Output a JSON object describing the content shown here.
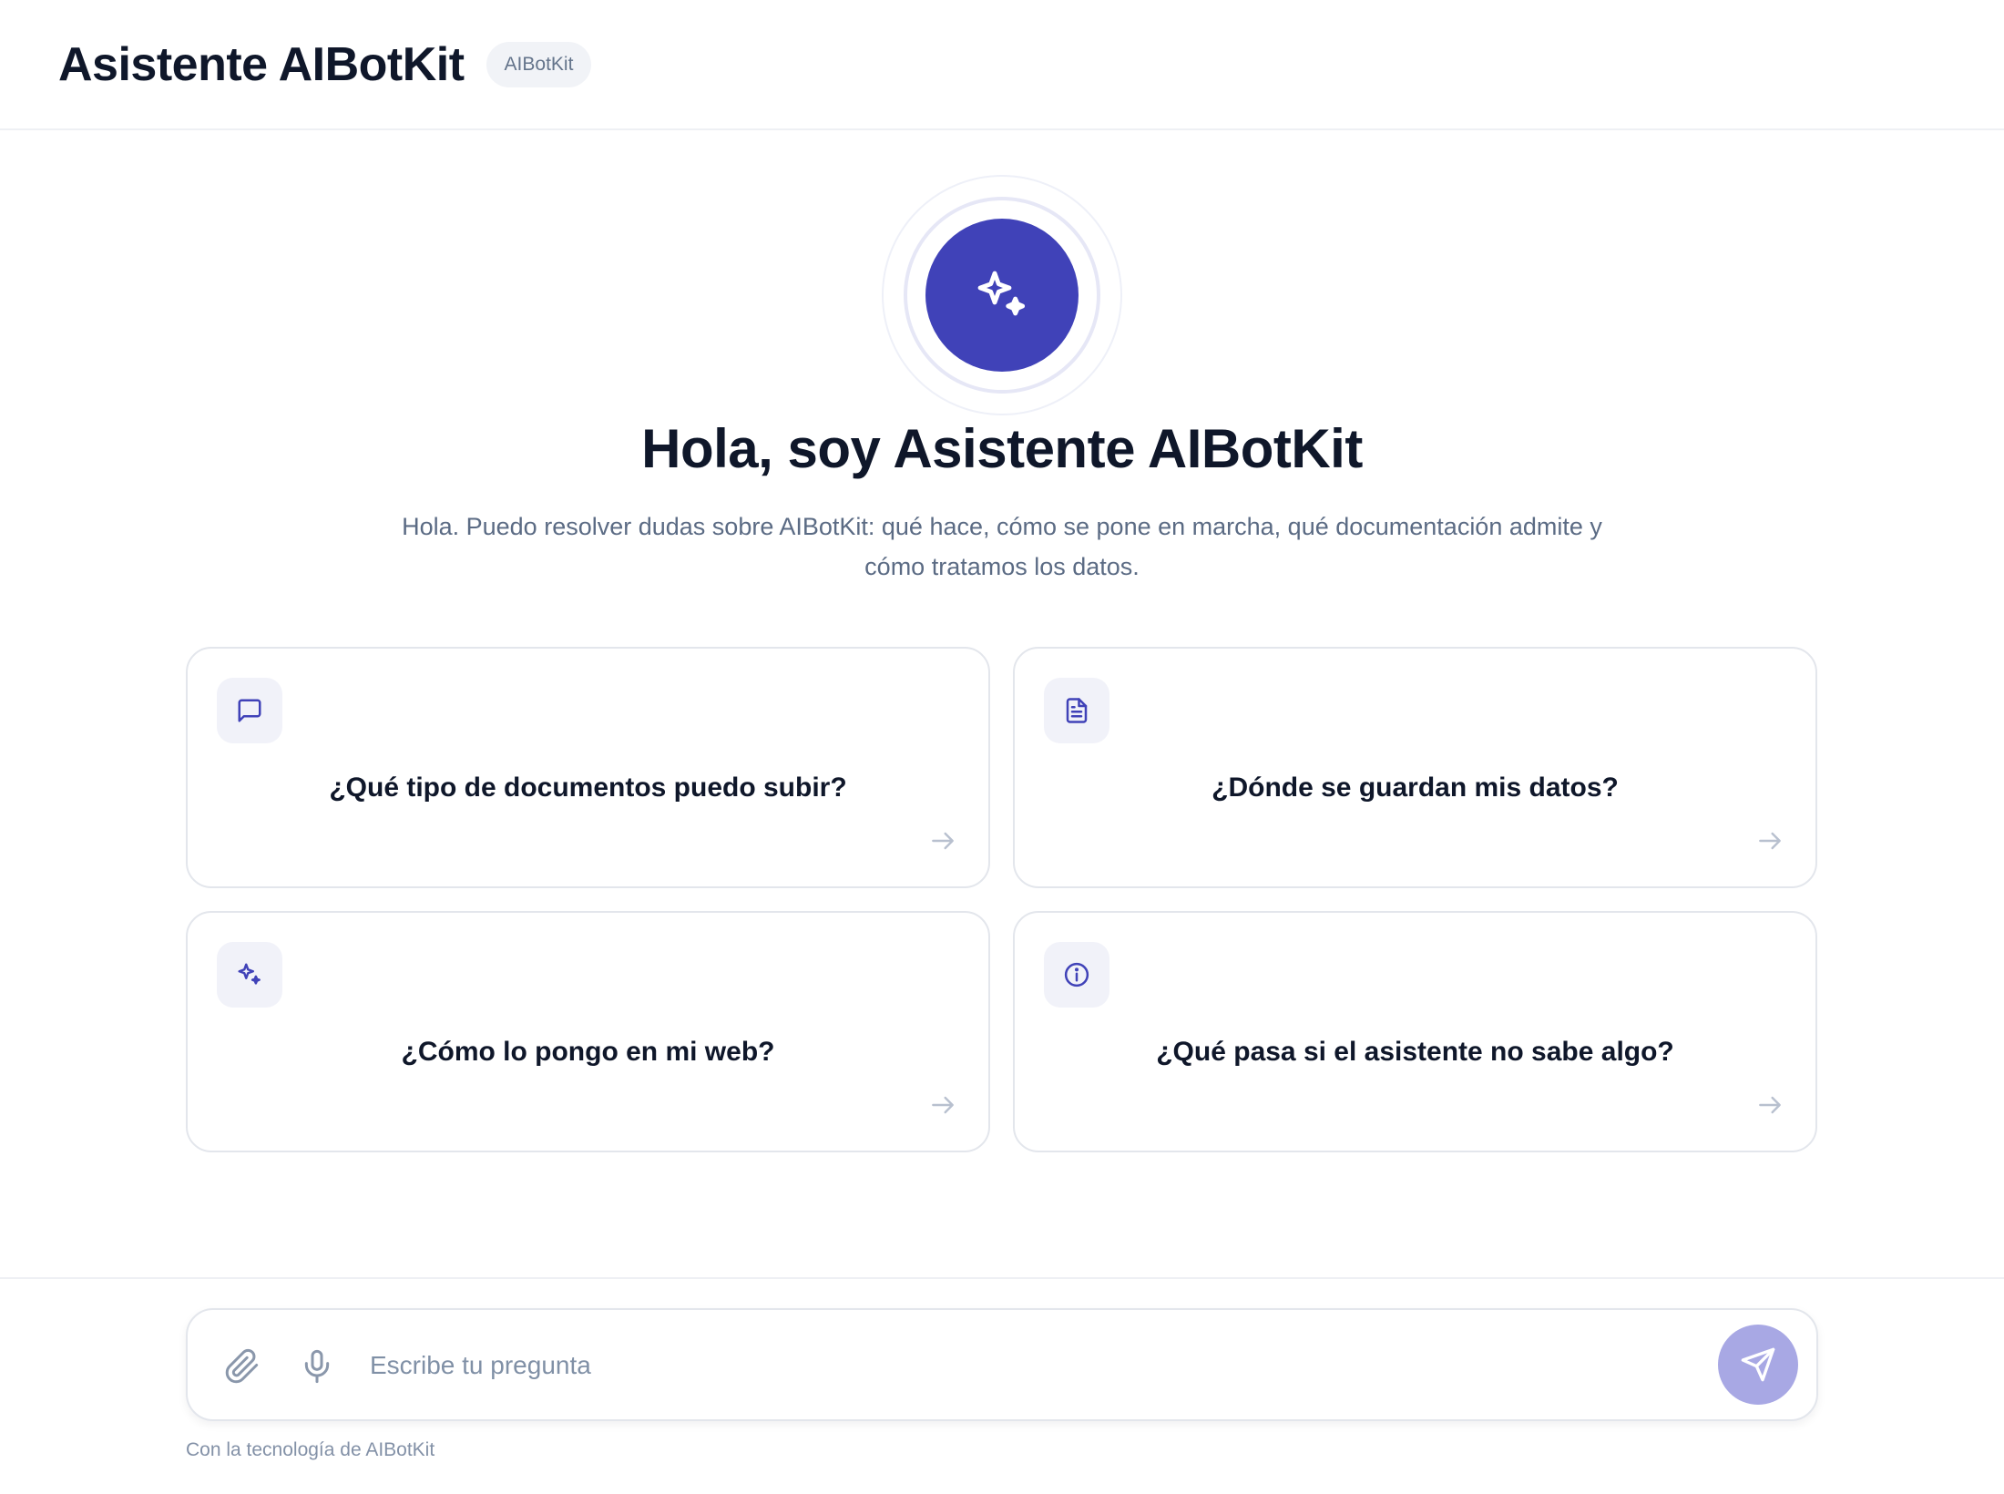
{
  "header": {
    "title": "Asistente AIBotKit",
    "badge": "AIBotKit"
  },
  "hero": {
    "icon": "sparkles-icon",
    "title": "Hola, soy Asistente AIBotKit",
    "subtitle": "Hola. Puedo resolver dudas sobre AIBotKit: qué hace, cómo se pone en marcha, qué documentación admite y cómo tratamos los datos."
  },
  "suggestions": [
    {
      "icon": "message-square-icon",
      "label": "¿Qué tipo de documentos puedo subir?"
    },
    {
      "icon": "file-text-icon",
      "label": "¿Dónde se guardan mis datos?"
    },
    {
      "icon": "sparkles-icon",
      "label": "¿Cómo lo pongo en mi web?"
    },
    {
      "icon": "info-circle-icon",
      "label": "¿Qué pasa si el asistente no sabe algo?"
    }
  ],
  "composer": {
    "placeholder": "Escribe tu pregunta",
    "value": ""
  },
  "footer": {
    "powered_by": "Con la tecnología de AIBotKit"
  },
  "colors": {
    "accent": "#4042b8",
    "send_button": "#a8a8e4",
    "text": "#0f172a",
    "muted": "#5b6b84"
  }
}
